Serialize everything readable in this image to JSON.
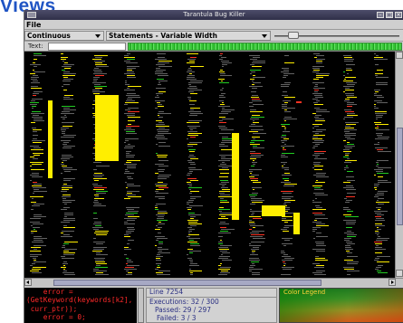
{
  "slide": {
    "title": "Views"
  },
  "window": {
    "title": "Tarantula Bug Killer",
    "buttons": [
      "–",
      "□",
      "×"
    ]
  },
  "menu": {
    "file_label": "File"
  },
  "toolbar": {
    "mode_value": "Continuous",
    "view_value": "Statements - Variable Width",
    "zoom_level": 0.12
  },
  "textbar": {
    "label": "Text:",
    "value": ""
  },
  "code_snippet": {
    "lines": [
      "    error =",
      "(GetKeyword(keywords[k2],",
      " curr_ptr));",
      "    error = 0;"
    ]
  },
  "info": {
    "line": "Line 7254",
    "executions": "Executions: 32 / 300",
    "passed": "Passed: 29 / 297",
    "failed": "Failed: 3 / 3"
  },
  "legend": {
    "title": "Color Legend"
  },
  "colors": {
    "code_bg": "#000000",
    "yellow": "#ffee00",
    "red": "#ff3322",
    "green": "#22cc22",
    "gray": "#b5b5b5",
    "accent_title": "#1f54c4"
  }
}
